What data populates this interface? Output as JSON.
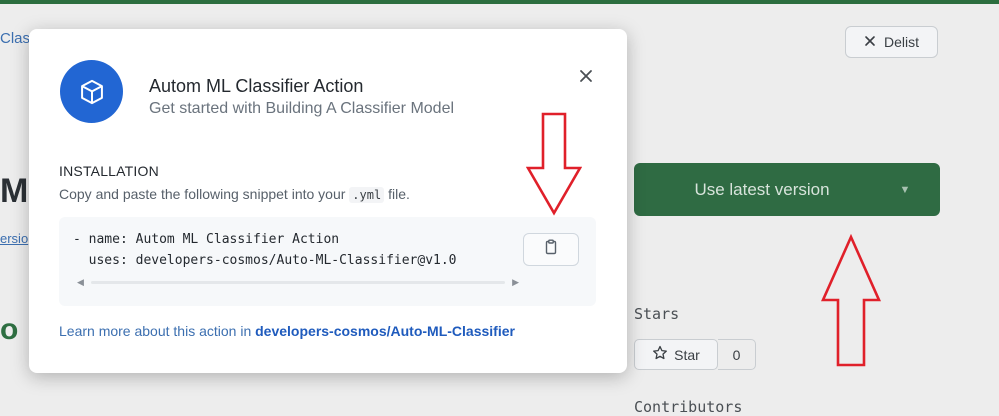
{
  "background": {
    "partial_crumb": "Clas",
    "partial_title": "MI",
    "partial_link": "ersio",
    "partial_heading": "o",
    "delist_label": "Delist",
    "use_latest_label": "Use latest version",
    "stars_label": "Stars",
    "star_button_label": "Star",
    "star_count": "0",
    "contributors_label": "Contributors"
  },
  "modal": {
    "title": "Autom ML Classifier Action",
    "subtitle": "Get started with Building A Classifier Model",
    "installation_heading": "INSTALLATION",
    "installation_desc_before": "Copy and paste the following snippet into your ",
    "installation_desc_code": ".yml",
    "installation_desc_after": " file.",
    "snippet": "- name: Autom ML Classifier Action\n  uses: developers-cosmos/Auto-ML-Classifier@v1.0",
    "learn_more_prefix": "Learn more about this action in ",
    "learn_more_link": "developers-cosmos/Auto-ML-Classifier"
  },
  "icons": [
    "cube-icon",
    "close-icon",
    "clipboard-icon",
    "x-icon",
    "star-icon",
    "chevron-down-icon"
  ],
  "colors": {
    "accent_blue": "#2266d3",
    "primary_green": "#2f6b43",
    "link_blue": "#1f5bbd",
    "annotation_red": "#e0202a"
  }
}
